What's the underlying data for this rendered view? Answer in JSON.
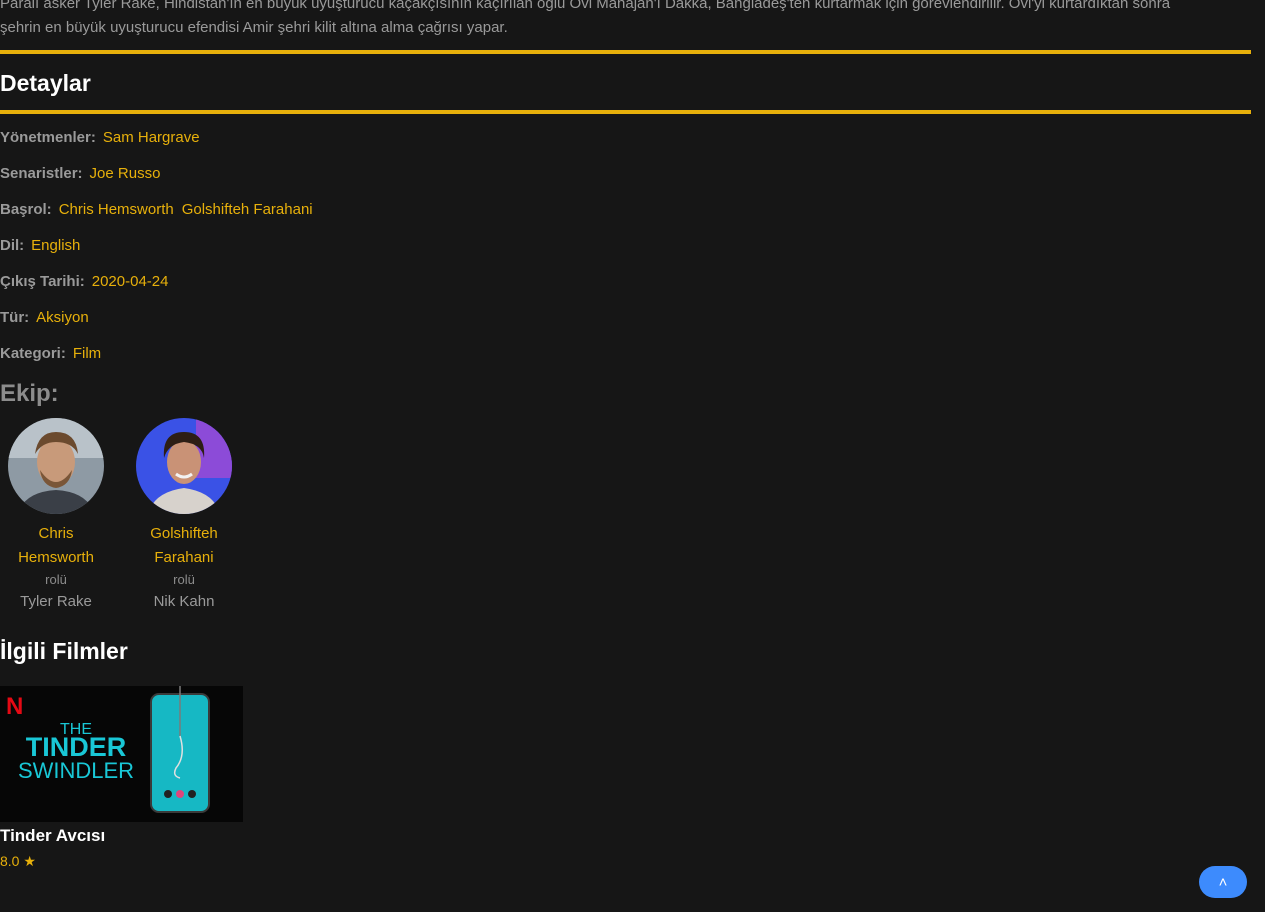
{
  "synopsis": {
    "line1": "Paralı asker Tyler Rake, Hindistan'ın en büyük uyuşturucu kaçakçısının kaçırılan oğlu Ovi Mahajan'ı Dakka, Bangladeş'ten kurtarmak için görevlendirilir. Ovi'yi kurtardıktan sonra",
    "line2": "şehrin en büyük uyuşturucu efendisi Amir şehri kilit altına alma çağrısı yapar."
  },
  "details": {
    "title": "Detaylar",
    "directors_label": "Yönetmenler:",
    "directors": [
      "Sam Hargrave"
    ],
    "writers_label": "Senaristler:",
    "writers": [
      "Joe Russo"
    ],
    "cast_label": "Başrol:",
    "cast": [
      "Chris Hemsworth",
      "Golshifteh Farahani"
    ],
    "language_label": "Dil:",
    "language": "English",
    "release_label": "Çıkış Tarihi:",
    "release": "2020-04-24",
    "genre_label": "Tür:",
    "genre": "Aksiyon",
    "category_label": "Kategori:",
    "category": "Film"
  },
  "crew": {
    "title": "Ekip:",
    "members": [
      {
        "name_line1": "Chris",
        "name_line2": "Hemsworth",
        "role_label": "rolü",
        "character": "Tyler Rake"
      },
      {
        "name_line1": "Golshifteh",
        "name_line2": "Farahani",
        "role_label": "rolü",
        "character": "Nik Kahn"
      }
    ]
  },
  "related": {
    "title": "İlgili Filmler",
    "items": [
      {
        "poster_brand": "N",
        "poster_line1": "THE",
        "poster_line2": "TINDER",
        "poster_line3": "SWINDLER",
        "title": "Tinder Avcısı",
        "rating": "8.0"
      }
    ]
  },
  "colors": {
    "accent": "#e7b00b",
    "background": "#161616",
    "button": "#3d8bfd"
  },
  "icons": {
    "rating": "star-icon",
    "scroll_top": "chevron-double-up-icon"
  }
}
